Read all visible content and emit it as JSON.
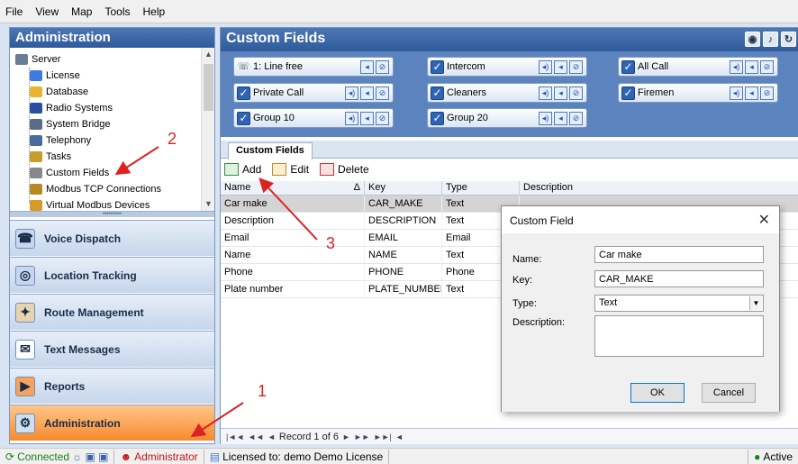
{
  "menu": [
    "File",
    "View",
    "Map",
    "Tools",
    "Help"
  ],
  "left": {
    "title": "Administration",
    "tree": [
      {
        "label": "Server",
        "icon": "server-icon",
        "color": "#6a7d96"
      },
      {
        "label": "License",
        "icon": "license-icon",
        "color": "#3d7be0"
      },
      {
        "label": "Database",
        "icon": "database-icon",
        "color": "#e9b531"
      },
      {
        "label": "Radio Systems",
        "icon": "radio-icon",
        "color": "#2b4f9c"
      },
      {
        "label": "System Bridge",
        "icon": "bridge-icon",
        "color": "#5a6b88"
      },
      {
        "label": "Telephony",
        "icon": "telephony-icon",
        "color": "#4a6a9e"
      },
      {
        "label": "Tasks",
        "icon": "tasks-icon",
        "color": "#c99b2a"
      },
      {
        "label": "Custom Fields",
        "icon": "custom-fields-icon",
        "color": "#888888"
      },
      {
        "label": "Modbus TCP Connections",
        "icon": "modbus-icon",
        "color": "#b58a22"
      },
      {
        "label": "Virtual Modbus Devices",
        "icon": "virtual-modbus-icon",
        "color": "#d79a26"
      }
    ],
    "nav": [
      {
        "label": "Voice Dispatch",
        "icon": "voice-dispatch-icon"
      },
      {
        "label": "Location Tracking",
        "icon": "location-tracking-icon"
      },
      {
        "label": "Route Management",
        "icon": "route-management-icon"
      },
      {
        "label": "Text Messages",
        "icon": "text-messages-icon"
      },
      {
        "label": "Reports",
        "icon": "reports-icon"
      },
      {
        "label": "Administration",
        "icon": "administration-icon"
      }
    ]
  },
  "main": {
    "title": "Custom Fields",
    "groups": [
      {
        "label": "1: Line free",
        "checked": false
      },
      {
        "label": "Intercom",
        "checked": true
      },
      {
        "label": "All Call",
        "checked": true
      },
      {
        "label": "Private Call",
        "checked": true
      },
      {
        "label": "Cleaners",
        "checked": true
      },
      {
        "label": "Firemen",
        "checked": true
      },
      {
        "label": "Group 10",
        "checked": true
      },
      {
        "label": "Group 20",
        "checked": true
      }
    ],
    "tab": "Custom Fields",
    "toolbar": {
      "add": "Add",
      "edit": "Edit",
      "delete": "Delete"
    },
    "columns": [
      "Name",
      "Key",
      "Type",
      "Description"
    ],
    "sort_glyph": "Δ",
    "rows": [
      [
        "Car make",
        "CAR_MAKE",
        "Text",
        ""
      ],
      [
        "Description",
        "DESCRIPTION",
        "Text",
        ""
      ],
      [
        "Email",
        "EMAIL",
        "Email",
        ""
      ],
      [
        "Name",
        "NAME",
        "Text",
        ""
      ],
      [
        "Phone",
        "PHONE",
        "Phone",
        ""
      ],
      [
        "Plate number",
        "PLATE_NUMBER",
        "Text",
        ""
      ]
    ],
    "pager": "Record 1 of 6"
  },
  "dialog": {
    "title": "Custom Field",
    "name_label": "Name:",
    "name_value": "Car make",
    "key_label": "Key:",
    "key_value": "CAR_MAKE",
    "type_label": "Type:",
    "type_value": "Text",
    "description_label": "Description:",
    "ok": "OK",
    "cancel": "Cancel"
  },
  "annotations": [
    "1",
    "2",
    "3"
  ],
  "status": {
    "connected": "Connected",
    "user": "Administrator",
    "license": "Licensed to: demo Demo License",
    "active": "Active"
  }
}
